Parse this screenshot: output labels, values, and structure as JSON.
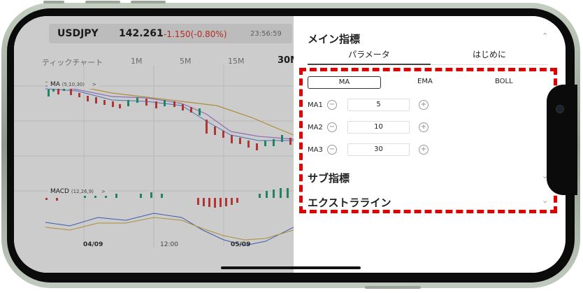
{
  "ticker": {
    "symbol": "USDJPY",
    "price": "142.261",
    "change": "-1.150(-0.80%)",
    "time": "23:56:59"
  },
  "timeframes": [
    "ティックチャート",
    "1M",
    "5M",
    "15M",
    "30M"
  ],
  "active_timeframe": "30M",
  "chart": {
    "main_indicator_chip": "MA",
    "main_indicator_params": "(5,10,30)",
    "sub_indicator_chip": "MACD",
    "sub_indicator_params": "(12,26,9)",
    "chip_arrow": ">",
    "dates": [
      "04/09",
      "12:00",
      "05/09"
    ]
  },
  "panel": {
    "main_title": "メイン指標",
    "collapse_icon": "chevron-up-icon",
    "tabs": [
      "パラメータ",
      "はじめに"
    ],
    "active_tab": "パラメータ",
    "indicator_options": [
      "MA",
      "EMA",
      "BOLL"
    ],
    "selected_indicator": "MA",
    "rows": [
      {
        "label": "MA1",
        "value": "5"
      },
      {
        "label": "MA2",
        "value": "10"
      },
      {
        "label": "MA3",
        "value": "30"
      }
    ],
    "sub_title": "サブ指標",
    "extra_title": "エクストラライン",
    "chevron_up": "⌃",
    "chevron_down": "⌄"
  },
  "colors": {
    "negative": "#e0362b",
    "annotation": "#e00000",
    "phone_frame": "#a3ae9f"
  }
}
